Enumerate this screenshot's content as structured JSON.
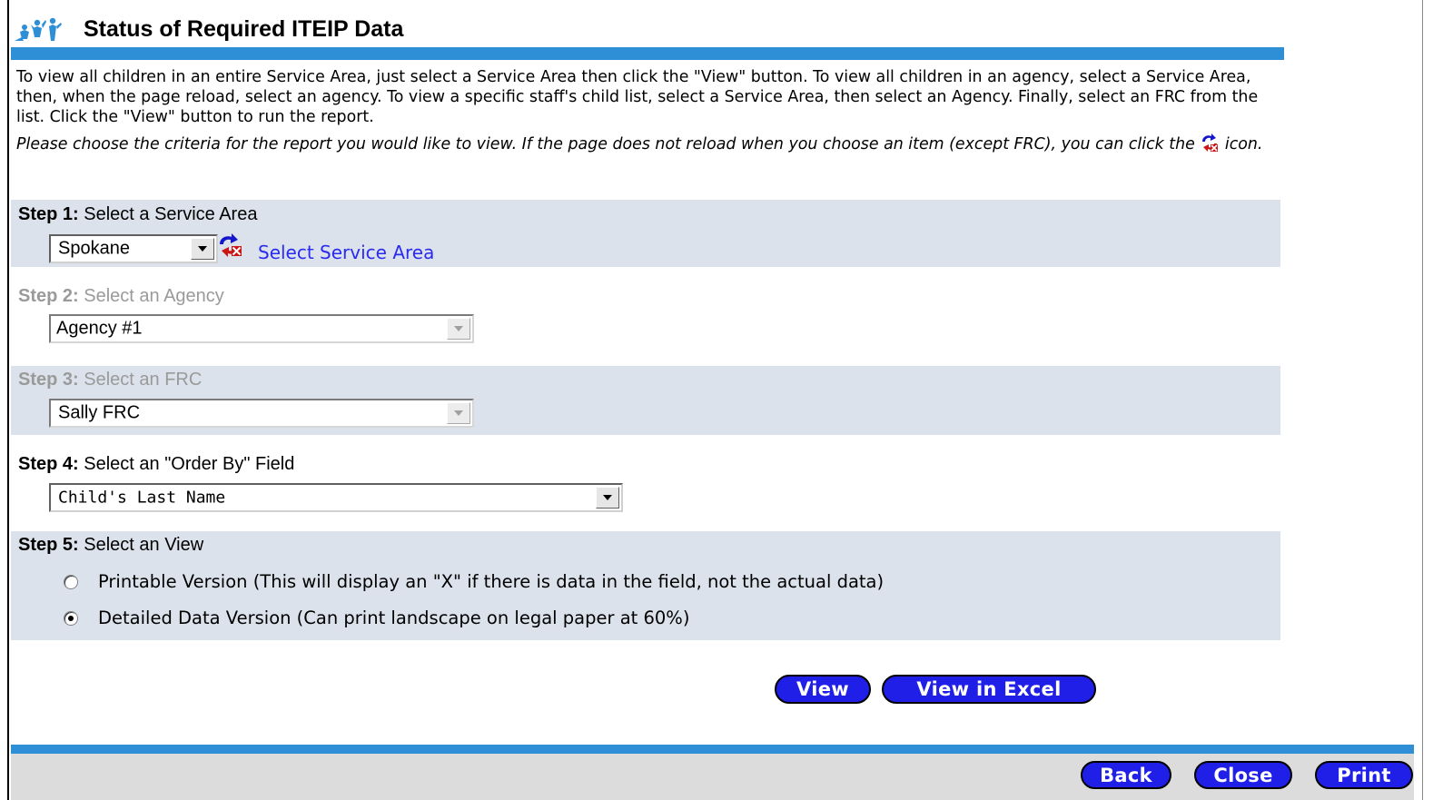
{
  "page": {
    "title": "Status of Required ITEIP Data",
    "intro": "To view all children in an entire Service Area, just select a Service Area then click the \"View\" button. To view all children in an agency, select a Service Area, then, when the page reload, select an agency. To view a specific staff's child list, select a Service Area, then select an Agency. Finally, select an FRC from the list. Click the \"View\" button to run the report.",
    "instruction_pre": "Please choose the criteria for the report you would like to view. If the page does not reload when you choose an item (except FRC), you can click the",
    "instruction_post": "icon."
  },
  "step1": {
    "label_bold": "Step 1:",
    "label": "Select a Service Area",
    "value": "Spokane",
    "link": "Select Service Area"
  },
  "step2": {
    "label_bold": "Step 2:",
    "label": "Select an Agency",
    "value": "Agency #1"
  },
  "step3": {
    "label_bold": "Step 3:",
    "label": "Select an FRC",
    "value": "Sally FRC"
  },
  "step4": {
    "label_bold": "Step 4:",
    "label": "Select an \"Order By\" Field",
    "value": "Child's Last Name"
  },
  "step5": {
    "label_bold": "Step 5:",
    "label": "Select an View",
    "options": [
      {
        "label": "Printable Version (This will display an \"X\" if there is data in the field, not the actual data)",
        "checked": false
      },
      {
        "label": "Detailed Data Version (Can print landscape on legal paper at 60%)",
        "checked": true
      }
    ]
  },
  "actions": {
    "view": "View",
    "view_excel": "View in Excel"
  },
  "footer": {
    "back": "Back",
    "close": "Close",
    "print": "Print"
  },
  "colors": {
    "accent_bar": "#2e8fd6",
    "button_blue": "#1f1fe8",
    "step_shade": "#dbe2eb",
    "link": "#2a2af0"
  }
}
